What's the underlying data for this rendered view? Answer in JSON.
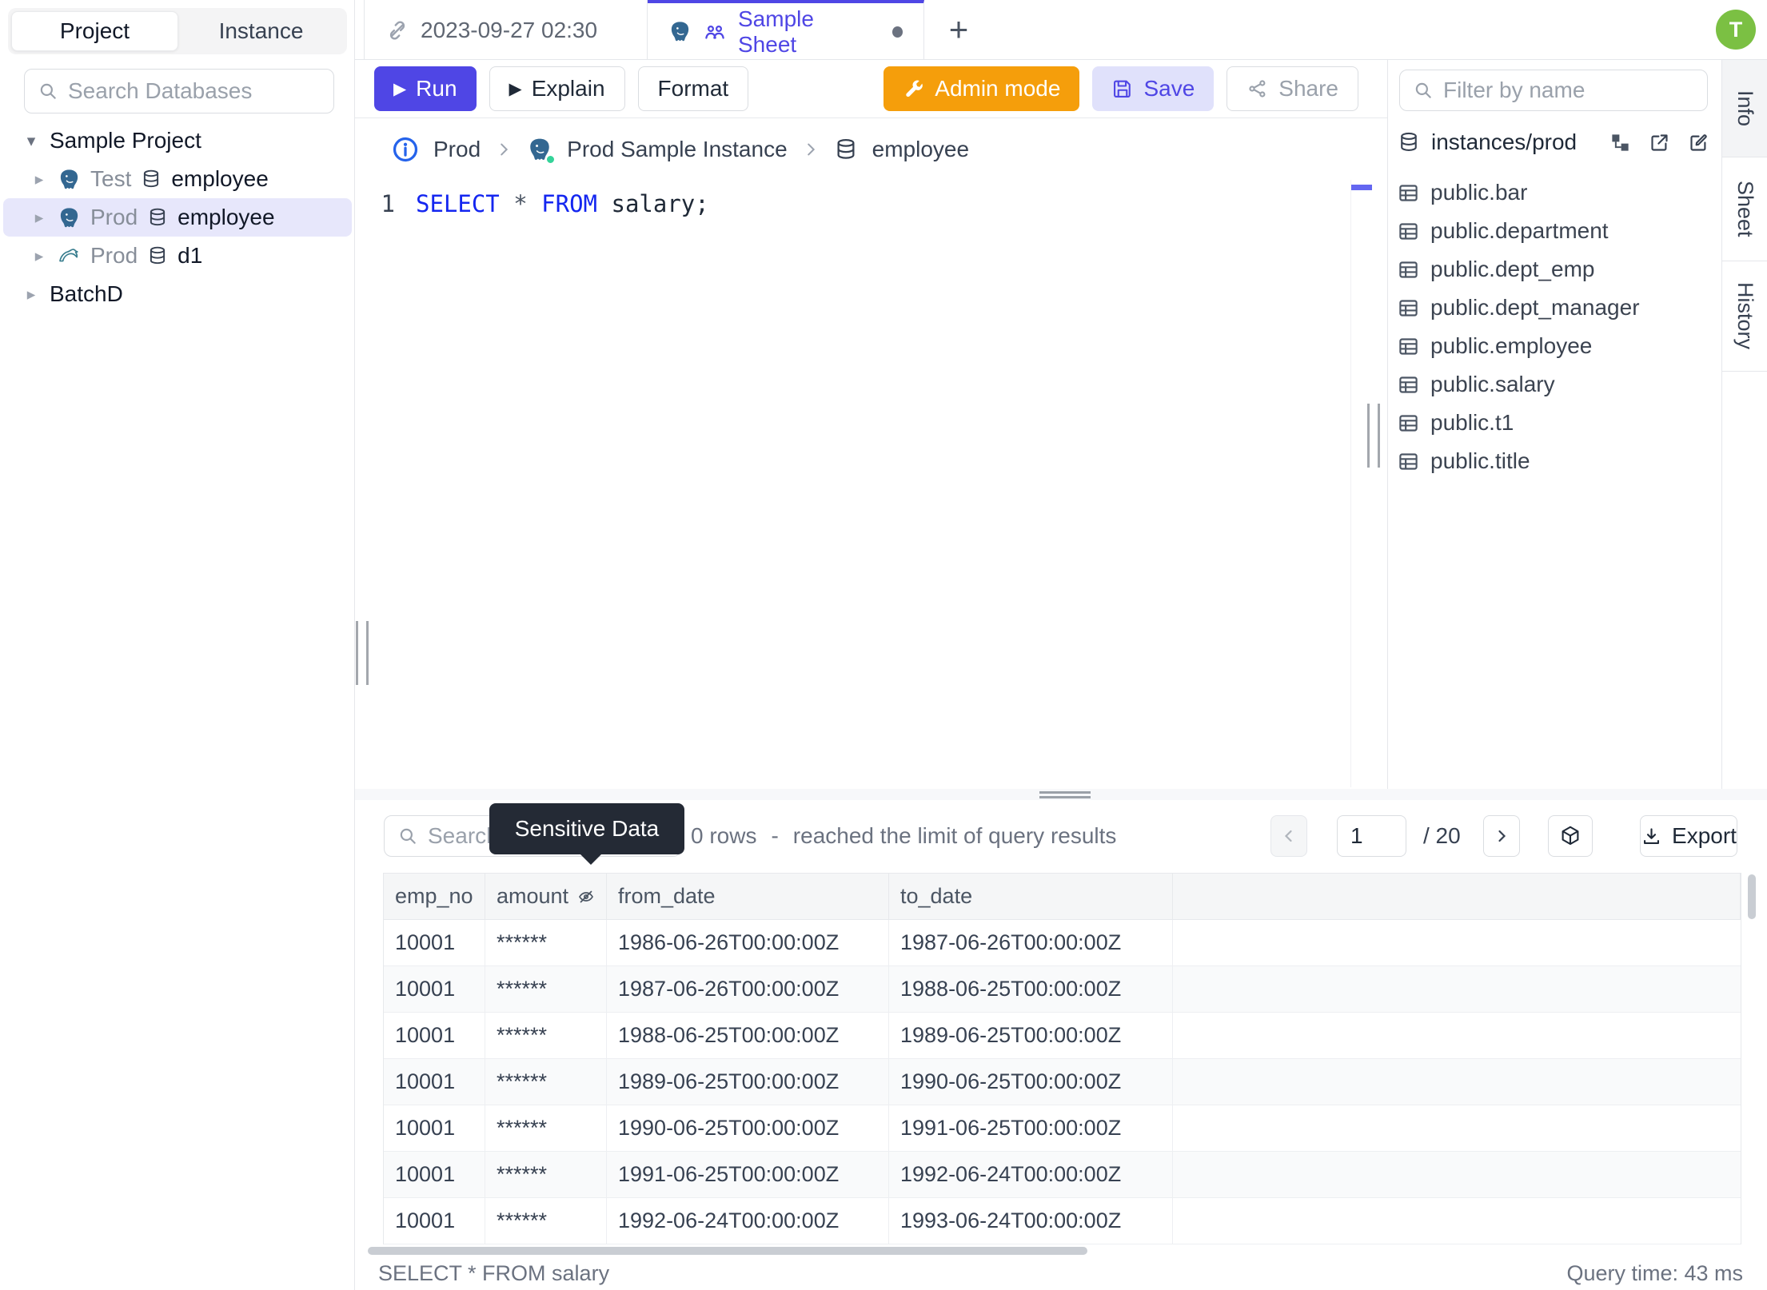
{
  "sidebar": {
    "tabs": [
      {
        "label": "Project"
      },
      {
        "label": "Instance"
      }
    ],
    "search_placeholder": "Search Databases",
    "tree": {
      "project": "Sample Project",
      "items": [
        {
          "env": "Test",
          "db": "employee",
          "engine": "postgresql"
        },
        {
          "env": "Prod",
          "db": "employee",
          "engine": "postgresql",
          "selected": true
        },
        {
          "env": "Prod",
          "db": "d1",
          "engine": "mysql"
        }
      ],
      "project2": "BatchD"
    }
  },
  "tabbar": {
    "tab1": "2023-09-27 02:30",
    "tab2": "Sample Sheet",
    "new_tab": "+"
  },
  "avatar": {
    "initial": "T"
  },
  "toolbar": {
    "run": "Run",
    "explain": "Explain",
    "format": "Format",
    "admin_mode": "Admin mode",
    "save": "Save",
    "share": "Share"
  },
  "breadcrumb": {
    "environment": "Prod",
    "instance": "Prod Sample Instance",
    "database": "employee"
  },
  "editor": {
    "line_number": "1",
    "kw_select": "SELECT",
    "star": "*",
    "kw_from": "FROM",
    "rest": "salary;"
  },
  "schema_panel": {
    "filter_placeholder": "Filter by name",
    "connection": "instances/prod",
    "tables": [
      "public.bar",
      "public.department",
      "public.dept_emp",
      "public.dept_manager",
      "public.employee",
      "public.salary",
      "public.t1",
      "public.title"
    ]
  },
  "right_tabs": {
    "info": "Info",
    "sheet": "Sheet",
    "history": "History"
  },
  "results": {
    "search_placeholder": "Search",
    "tooltip": "Sensitive Data",
    "rows_text": "0 rows",
    "separator": "-",
    "limit_text": "reached the limit of query results",
    "page": "1",
    "page_total": "/ 20",
    "export_label": "Export",
    "table": {
      "columns": [
        "emp_no",
        "amount",
        "from_date",
        "to_date"
      ],
      "rows": [
        [
          "10001",
          "******",
          "1986-06-26T00:00:00Z",
          "1987-06-26T00:00:00Z"
        ],
        [
          "10001",
          "******",
          "1987-06-26T00:00:00Z",
          "1988-06-25T00:00:00Z"
        ],
        [
          "10001",
          "******",
          "1988-06-25T00:00:00Z",
          "1989-06-25T00:00:00Z"
        ],
        [
          "10001",
          "******",
          "1989-06-25T00:00:00Z",
          "1990-06-25T00:00:00Z"
        ],
        [
          "10001",
          "******",
          "1990-06-25T00:00:00Z",
          "1991-06-25T00:00:00Z"
        ],
        [
          "10001",
          "******",
          "1991-06-25T00:00:00Z",
          "1992-06-24T00:00:00Z"
        ],
        [
          "10001",
          "******",
          "1992-06-24T00:00:00Z",
          "1993-06-24T00:00:00Z"
        ]
      ]
    },
    "status_sql": "SELECT * FROM salary",
    "query_time": "Query time: 43 ms"
  },
  "colors": {
    "accent": "#4f46e5",
    "admin_orange": "#f59e0b",
    "avatar_green": "#7bc043",
    "keyword_blue": "#1426f0",
    "tooltip_bg": "#242a35",
    "postgres_blue": "#336791",
    "selected_row_bg": "#e7e7fb",
    "status_green": "#34d399"
  }
}
